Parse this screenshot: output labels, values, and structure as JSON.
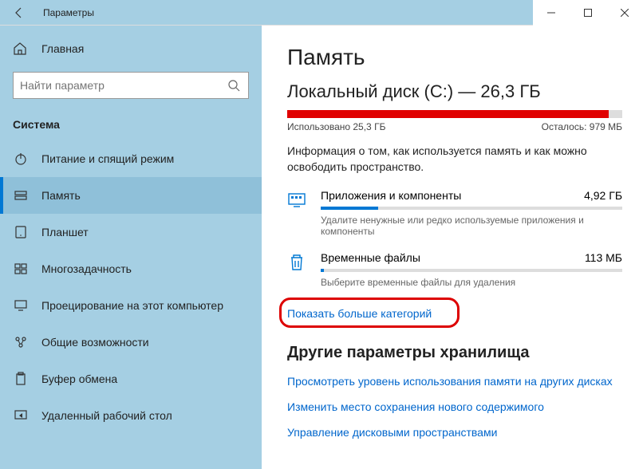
{
  "titlebar": {
    "title": "Параметры"
  },
  "sidebar": {
    "home": "Главная",
    "search_placeholder": "Найти параметр",
    "section": "Система",
    "items": [
      {
        "label": "Питание и спящий режим"
      },
      {
        "label": "Память"
      },
      {
        "label": "Планшет"
      },
      {
        "label": "Многозадачность"
      },
      {
        "label": "Проецирование на этот компьютер"
      },
      {
        "label": "Общие возможности"
      },
      {
        "label": "Буфер обмена"
      },
      {
        "label": "Удаленный рабочий стол"
      }
    ]
  },
  "content": {
    "title": "Память",
    "disk": "Локальный диск (C:) — 26,3 ГБ",
    "used": "Использовано 25,3 ГБ",
    "remaining": "Осталось: 979 МБ",
    "usage_pct": 96,
    "desc": "Информация о том, как используется память и как можно освободить пространство.",
    "categories": [
      {
        "name": "Приложения и компоненты",
        "size": "4,92 ГБ",
        "pct": 19,
        "hint": "Удалите ненужные или редко используемые приложения и компоненты"
      },
      {
        "name": "Временные файлы",
        "size": "113 МБ",
        "pct": 1,
        "hint": "Выберите временные файлы для удаления"
      }
    ],
    "show_more": "Показать больше категорий",
    "section2": "Другие параметры хранилища",
    "links": [
      "Просмотреть уровень использования памяти на других дисках",
      "Изменить место сохранения нового содержимого",
      "Управление дисковыми пространствами"
    ]
  }
}
